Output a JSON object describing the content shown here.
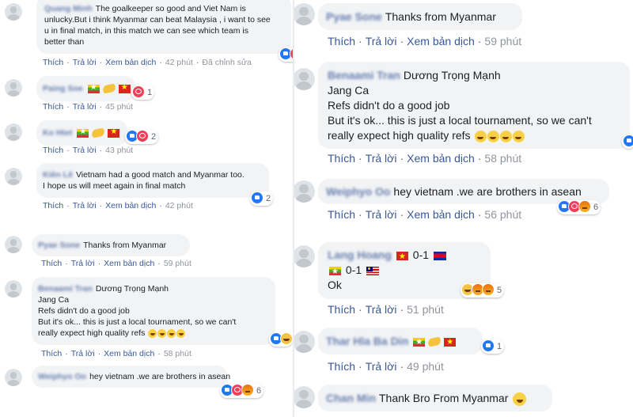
{
  "actions": {
    "like": "Thích",
    "reply": "Trả lời",
    "translate": "Xem bản dịch",
    "edited": "Đã chỉnh sửa"
  },
  "left": {
    "comments": [
      {
        "author": "Quang Minh",
        "lines": [
          "The goalkeeper so good and Viet Nam is",
          "unlucky.But i think Myanmar can beat Malaysia , i want to see",
          "u in final match, in this match we can see which team is",
          "better than"
        ],
        "time": "42 phút",
        "edited": true,
        "reactions": [
          "like",
          "love"
        ],
        "count": ""
      },
      {
        "author": "Paing Soe",
        "lines": [
          ""
        ],
        "icons": [
          "flag-mm",
          "handshake",
          "flag-vn"
        ],
        "time": "45 phút",
        "reactions": [
          "love"
        ],
        "count": "1"
      },
      {
        "author": "Ko Htet",
        "lines": [
          ""
        ],
        "icons": [
          "flag-mm",
          "handshake",
          "flag-vn"
        ],
        "time": "43 phút",
        "reactions": [
          "like",
          "love"
        ],
        "count": "2"
      },
      {
        "author": "Kiên Lê",
        "lines": [
          "Vietnam had a good match and Myanmar too.",
          "I hope us will meet again in final match"
        ],
        "time": "42 phút",
        "reactions": [
          "like"
        ],
        "count": "2"
      },
      {
        "author": "Pyae Sone",
        "lines": [
          "Thanks from Myanmar"
        ],
        "time": "59 phút"
      },
      {
        "author": "Benaami Tran",
        "mention": "Dương Trọng Mạnh",
        "lines": [
          "Jang Ca",
          "Refs didn't do a good job",
          "But it's ok... this is just a local tournament, so we can't",
          "really expect high quality refs"
        ],
        "time": "58 phút",
        "reactions": [
          "like",
          "haha"
        ],
        "count": ""
      },
      {
        "author": "Weiphyo Oo",
        "lines": [
          "hey vietnam .we are brothers in asean"
        ],
        "time": "56 phút",
        "reactions": [
          "like",
          "love",
          "angry"
        ],
        "count": "6"
      }
    ]
  },
  "right": {
    "comments": [
      {
        "author": "Pyae Sone",
        "lines": [
          "Thanks from Myanmar"
        ],
        "time": "59 phút"
      },
      {
        "author": "Benaami Tran",
        "mention": "Dương Trọng Mạnh",
        "lines": [
          "Jang Ca",
          "Refs didn't do a good job",
          "But it's ok... this is just a local tournament, so we can't",
          "really expect high quality refs"
        ],
        "time": "58 phút",
        "reactions": [
          "like"
        ],
        "count": ""
      },
      {
        "author": "Weiphyo Oo",
        "lines": [
          "hey vietnam .we are brothers in asean"
        ],
        "time": "56 phút",
        "reactions": [
          "like",
          "love",
          "angry"
        ],
        "count": "6"
      },
      {
        "author": "Lang Hoang",
        "lines": [
          "0-1",
          "0-1",
          "Ok"
        ],
        "time": "51 phút",
        "reactions": [
          "haha",
          "angry"
        ],
        "count": "5"
      },
      {
        "author": "Thar Hla Ba Din",
        "lines": [
          ""
        ],
        "icons": [
          "flag-mm",
          "handshake",
          "flag-vn"
        ],
        "time": "49 phút",
        "reactions": [
          "like"
        ],
        "count": "1"
      },
      {
        "author": "Chan Min",
        "lines": [
          "Thank Bro From Myanmar"
        ],
        "time": ""
      }
    ]
  }
}
